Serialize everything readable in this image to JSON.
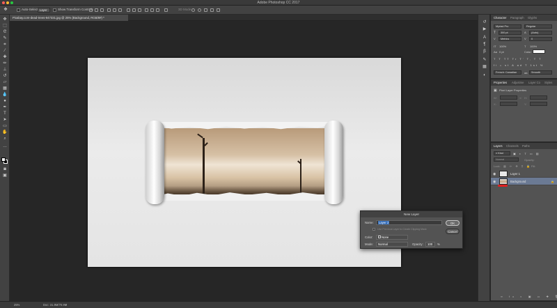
{
  "window": {
    "title": "Adobe Photoshop CC 2017"
  },
  "options_bar": {
    "auto_select_label": "Auto-Select:",
    "auto_select_value": "Layer",
    "show_transform_label": "Show Transform Controls",
    "mode_3d_label": "3D Mode:"
  },
  "document_tab": {
    "label": "Pixabay.com-dead-trees-947331.jpg @ 25% (Background, RGB/8#) *"
  },
  "toolbar": {
    "tools": [
      "move-tool",
      "marquee-tool",
      "lasso-tool",
      "quick-select-tool",
      "crop-tool",
      "eyedropper-tool",
      "healing-tool",
      "brush-tool",
      "clone-stamp-tool",
      "history-brush-tool",
      "eraser-tool",
      "gradient-tool",
      "blur-tool",
      "dodge-tool",
      "pen-tool",
      "type-tool",
      "path-select-tool",
      "rectangle-tool",
      "hand-tool",
      "zoom-tool"
    ]
  },
  "character_panel": {
    "tabs": [
      "Character",
      "Paragraph",
      "Glyphs"
    ],
    "font_family": "Myriad Pro",
    "font_style": "Regular",
    "font_size": "300 pt",
    "leading": "(Auto)",
    "kerning": "Metrics",
    "tracking": "0",
    "vertical_scale": "100%",
    "horizontal_scale": "100%",
    "baseline_shift": "0 pt",
    "color_label": "Color:",
    "language": "French: Canadian",
    "antialias_symbol": "aa",
    "antialias": "Smooth"
  },
  "properties_panel": {
    "tabs": [
      "Properties",
      "Adjustme",
      "Layer Co",
      "Styles"
    ],
    "title": "Pixel Layer Properties",
    "w_label": "W:",
    "h_label": "H:",
    "x_label": "X:",
    "y_label": "Y:"
  },
  "layers_panel": {
    "tabs": [
      "Layers",
      "Channels",
      "Paths"
    ],
    "kind_filter": "Kind",
    "blend_mode": "Normal",
    "opacity_label": "Opacity:",
    "lock_label": "Lock:",
    "fill_label": "Fill:",
    "layers": [
      {
        "name": "Layer 1",
        "selected": false
      },
      {
        "name": "Background",
        "selected": true
      }
    ]
  },
  "new_layer_dialog": {
    "title": "New Layer",
    "name_label": "Name:",
    "name_value": "Layer 2",
    "clipping_note": "Use Previous Layer to Create Clipping Mask",
    "color_label": "Color:",
    "color_value": "None",
    "mode_label": "Mode:",
    "mode_value": "Normal",
    "opacity_label": "Opacity:",
    "opacity_value": "100",
    "opacity_unit": "%",
    "ok_label": "OK",
    "cancel_label": "Cancel"
  },
  "status_bar": {
    "zoom": "25%",
    "doc_info": "Doc: 31.9M/70.9M"
  },
  "colors": {
    "accent_selection": "#2f6ab8",
    "layer_selected": "#6b7a94",
    "annotation_red": "#e02020"
  }
}
